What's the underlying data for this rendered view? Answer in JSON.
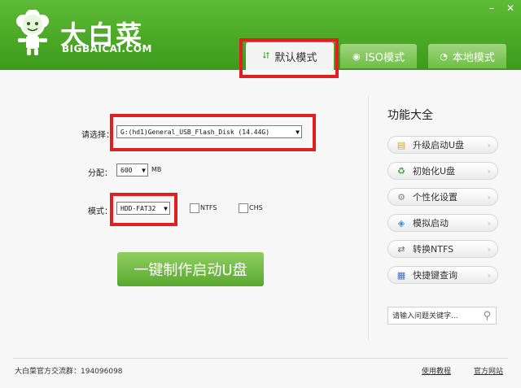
{
  "app": {
    "name": "大白菜",
    "url": "BIGBAICAI.COM",
    "window_controls": [
      "–",
      "✕"
    ]
  },
  "tabs": [
    {
      "label": "默认模式",
      "icon": "share-icon",
      "active": true
    },
    {
      "label": "ISO模式",
      "icon": "disc-icon",
      "active": false
    },
    {
      "label": "本地模式",
      "icon": "rss-icon",
      "active": false
    }
  ],
  "form": {
    "disk_label": "请选择：",
    "disk_value": "G:(hd1)General_USB_Flash_Disk (14.44G)",
    "alloc_label": "分配：",
    "alloc_value": "600",
    "alloc_unit": "MB",
    "mode_label": "模式：",
    "mode_value": "HDD-FAT32",
    "ntfs_label": "NTFS",
    "chs_label": "CHS",
    "make_button": "一键制作启动U盘"
  },
  "functions": {
    "title": "功能大全",
    "items": [
      {
        "label": "升级启动U盘",
        "icon": "folder-upgrade-icon"
      },
      {
        "label": "初始化U盘",
        "icon": "recycle-icon"
      },
      {
        "label": "个性化设置",
        "icon": "gear-icon"
      },
      {
        "label": "模拟启动",
        "icon": "simulate-icon"
      },
      {
        "label": "转换NTFS",
        "icon": "convert-icon"
      },
      {
        "label": "快捷键查询",
        "icon": "keyboard-icon"
      }
    ],
    "search_placeholder": "请输入问题关键字..."
  },
  "footer": {
    "group_text": "大白菜官方交流群：194096098",
    "tutorial_link": "使用教程",
    "website_link": "官方网站"
  },
  "colors": {
    "brand_green": "#4aa825",
    "highlight_red": "#e02020"
  }
}
